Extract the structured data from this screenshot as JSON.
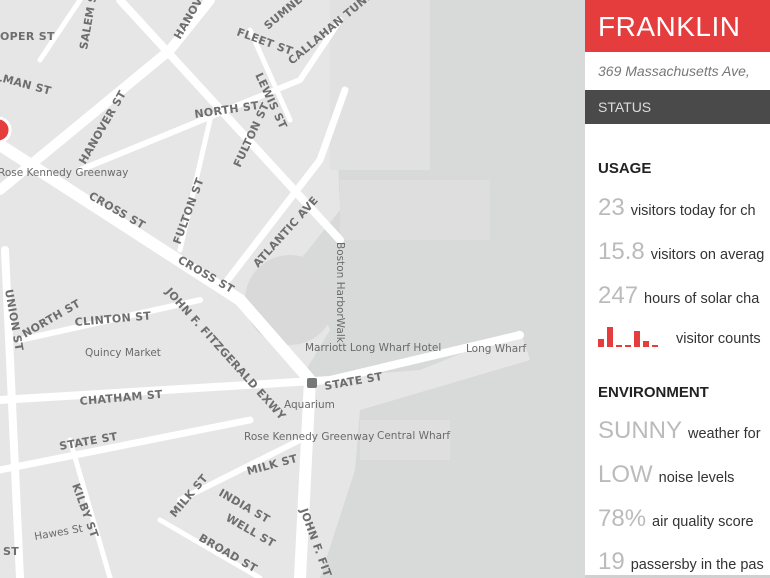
{
  "map": {
    "street_labels": [
      "OPER ST",
      "SALEM ST",
      "HANOVER ST",
      "SUMNER ST",
      "FLEET ST",
      "CALLAHAN TUNNEL",
      "LMAN ST",
      "LEWIS ST",
      "NORTH ST",
      "FULTON ST",
      "HANOVER ST",
      "CROSS ST",
      "FULTON ST",
      "CROSS ST",
      "ATLANTIC AVE",
      "NORTH ST",
      "CLINTON ST",
      "JOHN F. FITZGERALD EXWY",
      "UNION ST",
      "CHATHAM ST",
      "STATE ST",
      "STATE ST",
      "MILK ST",
      "INDIA ST",
      "KILBY ST",
      "MILK ST",
      "WELL ST",
      "BROAD ST",
      "Hawes St",
      "JOHN F. FIT",
      "ST"
    ],
    "place_labels": [
      "Rose Kennedy Greenway",
      "Quincy Market",
      "Marriott Long Wharf Hotel",
      "Long Wharf",
      "Aquarium",
      "Rose Kennedy Greenway",
      "Central Wharf",
      "Boston HarborWalk"
    ],
    "marker_color": "#e53d3d"
  },
  "panel": {
    "title": "FRANKLIN",
    "address": "369 Massachusetts Ave,",
    "status_label": "STATUS",
    "usage": {
      "heading": "USAGE",
      "items": [
        {
          "value": "23",
          "text": "visitors today for ch"
        },
        {
          "value": "15.8",
          "text": "visitors on averag"
        },
        {
          "value": "247",
          "text": "hours of solar cha"
        }
      ],
      "sparkline": {
        "values": [
          4,
          10,
          1,
          1,
          8,
          3,
          1
        ],
        "text": "visitor counts"
      }
    },
    "environment": {
      "heading": "ENVIRONMENT",
      "items": [
        {
          "value": "SUNNY",
          "text": "weather for"
        },
        {
          "value": "LOW",
          "text": "noise levels"
        },
        {
          "value": "78%",
          "text": "air quality score"
        },
        {
          "value": "19",
          "text": "passersby in the pas"
        }
      ]
    },
    "accent_color": "#e53d3d"
  }
}
